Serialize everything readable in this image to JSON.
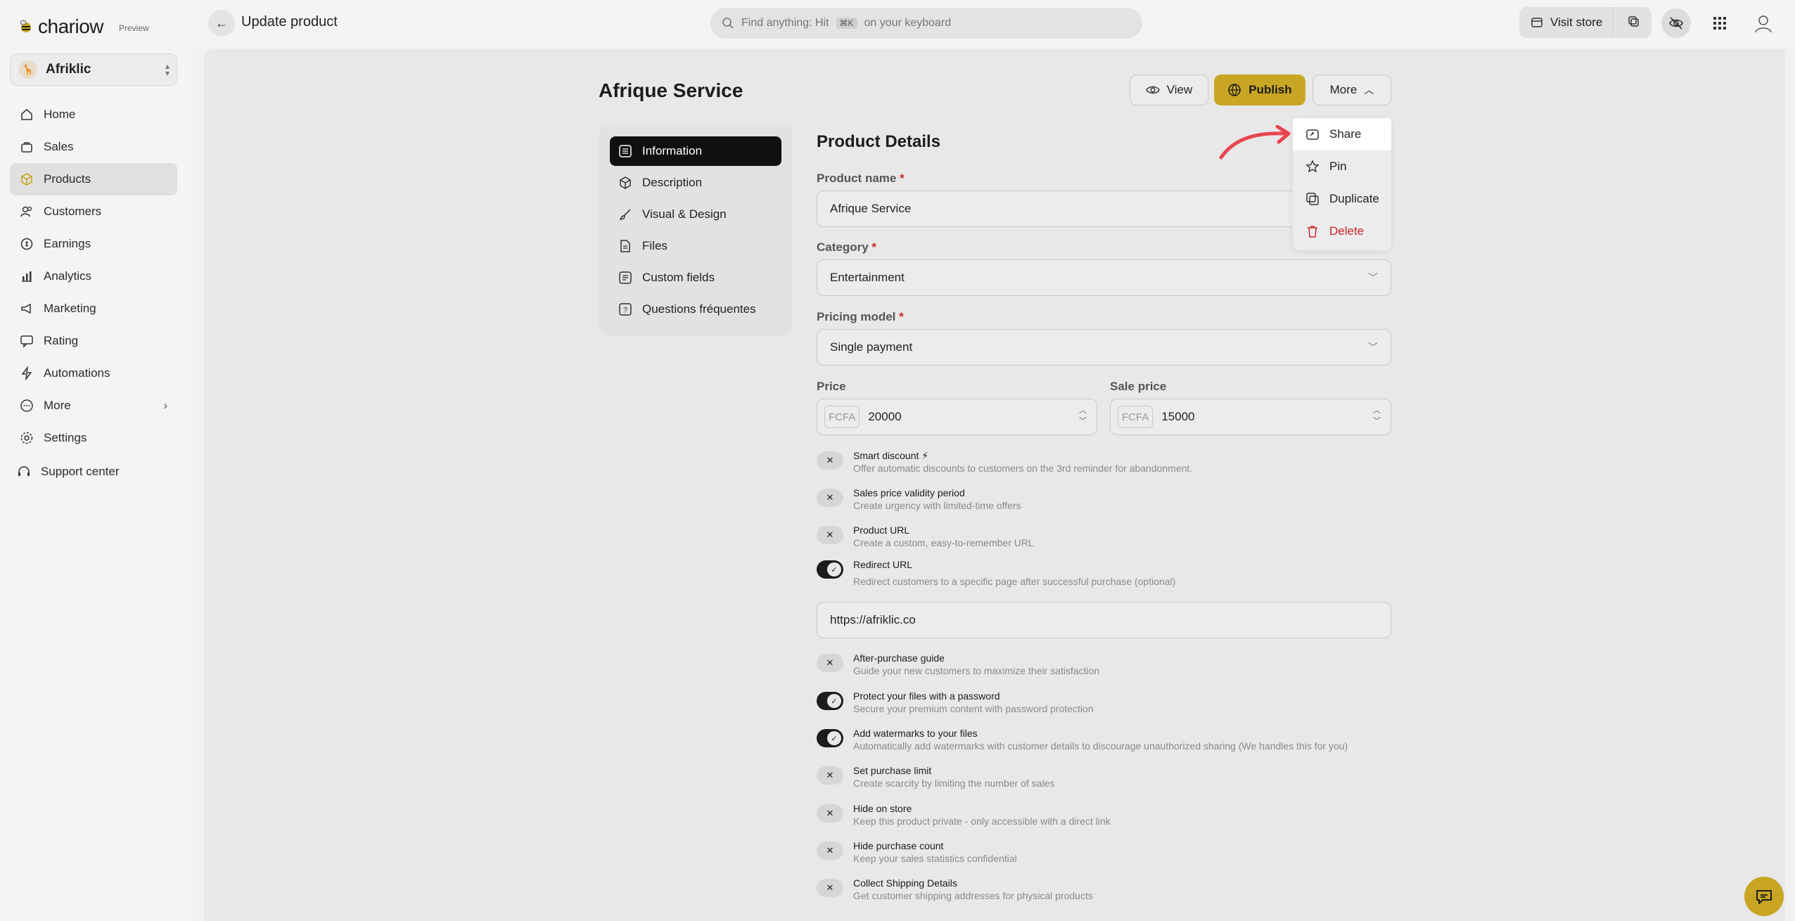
{
  "brand": {
    "name": "chariow",
    "tag": "Preview"
  },
  "header": {
    "title": "Update product",
    "search": {
      "prefix": "Find anything: Hit",
      "kbd": "⌘K",
      "suffix": "on your keyboard"
    },
    "visit_store": "Visit store"
  },
  "store": {
    "name": "Afriklic"
  },
  "sidebar": {
    "items": [
      {
        "label": "Home",
        "icon": "home-icon"
      },
      {
        "label": "Sales",
        "icon": "bag-icon"
      },
      {
        "label": "Products",
        "icon": "box-icon",
        "active": true
      },
      {
        "label": "Customers",
        "icon": "users-icon"
      },
      {
        "label": "Earnings",
        "icon": "coins-icon"
      },
      {
        "label": "Analytics",
        "icon": "chart-icon"
      },
      {
        "label": "Marketing",
        "icon": "megaphone-icon"
      },
      {
        "label": "Rating",
        "icon": "message-icon"
      },
      {
        "label": "Automations",
        "icon": "bolt-icon"
      },
      {
        "label": "More",
        "icon": "dots-icon"
      },
      {
        "label": "Settings",
        "icon": "gear-icon"
      },
      {
        "label": "Support center",
        "icon": "headset-icon"
      }
    ]
  },
  "page": {
    "title": "Afrique Service",
    "buttons": {
      "view": "View",
      "publish": "Publish",
      "more": "More"
    }
  },
  "tabs": [
    {
      "label": "Information"
    },
    {
      "label": "Description"
    },
    {
      "label": "Visual & Design"
    },
    {
      "label": "Files"
    },
    {
      "label": "Custom fields"
    },
    {
      "label": "Questions fréquentes"
    }
  ],
  "form": {
    "title": "Product Details",
    "product_name_label": "Product name",
    "product_name": "Afrique Service",
    "category_label": "Category",
    "category": "Entertainment",
    "pricing_model_label": "Pricing model",
    "pricing_model": "Single payment",
    "price_label": "Price",
    "price_currency": "FCFA",
    "price": "20000",
    "sale_price_label": "Sale price",
    "sale_price": "15000",
    "redirect_url_value": "https://afriklic.co",
    "required_mark": "*"
  },
  "toggles": [
    {
      "title": "Smart discount ⚡",
      "desc": "Offer automatic discounts to customers on the 3rd reminder for abandonment.",
      "on": false
    },
    {
      "title": "Sales price validity period",
      "desc": "Create urgency with limited-time offers",
      "on": false
    },
    {
      "title": "Product URL",
      "desc": "Create a custom, easy-to-remember URL",
      "on": false
    },
    {
      "title": "Redirect URL",
      "desc": "Redirect customers to a specific page after successful purchase (optional)",
      "on": true
    },
    {
      "title": "After-purchase guide",
      "desc": "Guide your new customers to maximize their satisfaction",
      "on": false
    },
    {
      "title": "Protect your files with a password",
      "desc": "Secure your premium content with password protection",
      "on": true
    },
    {
      "title": "Add watermarks to your files",
      "desc": "Automatically add watermarks with customer details to discourage unauthorized sharing (We handles this for you)",
      "on": true
    },
    {
      "title": "Set purchase limit",
      "desc": "Create scarcity by limiting the number of sales",
      "on": false
    },
    {
      "title": "Hide on store",
      "desc": "Keep this product private - only accessible with a direct link",
      "on": false
    },
    {
      "title": "Hide purchase count",
      "desc": "Keep your sales statistics confidential",
      "on": false
    },
    {
      "title": "Collect Shipping Details",
      "desc": "Get customer shipping addresses for physical products",
      "on": false
    }
  ],
  "more_menu": {
    "items": [
      {
        "label": "Share",
        "icon": "share-icon",
        "highlighted": true
      },
      {
        "label": "Pin",
        "icon": "star-icon"
      },
      {
        "label": "Duplicate",
        "icon": "duplicate-icon"
      },
      {
        "label": "Delete",
        "icon": "trash-icon",
        "danger": true
      }
    ]
  },
  "colors": {
    "accent": "#c8a623",
    "danger": "#c62828",
    "arrow": "#e8454f"
  }
}
